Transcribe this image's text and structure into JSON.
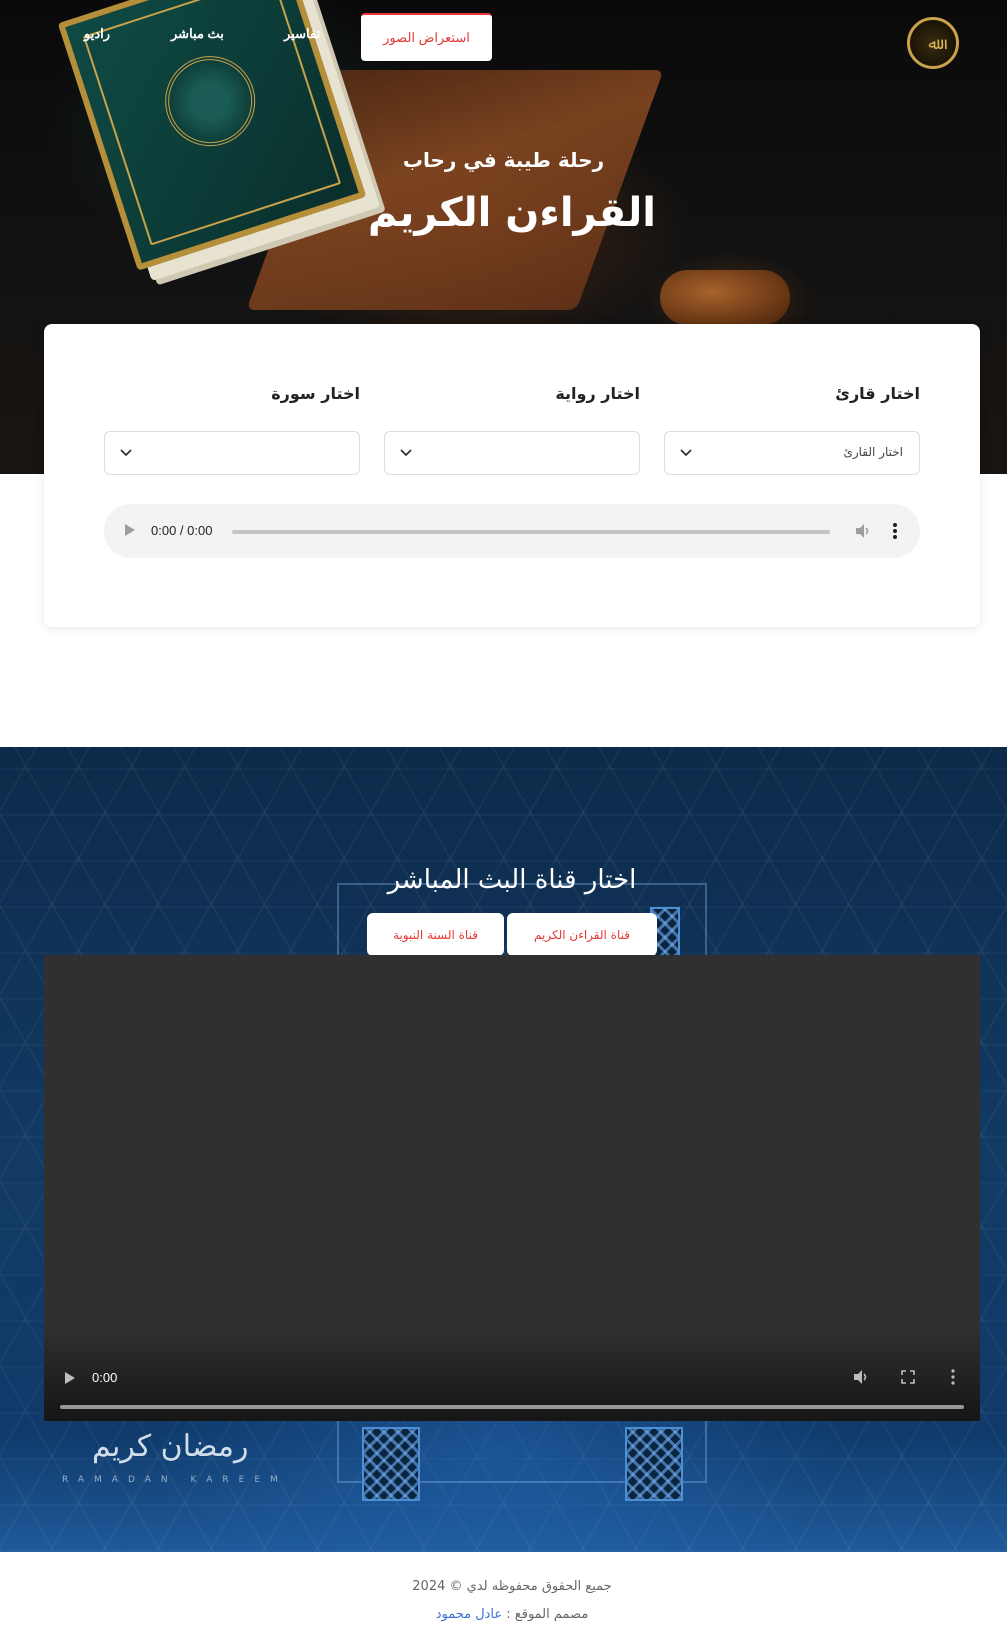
{
  "nav": {
    "logo_text": "ﷲ",
    "active": "استعراض الصور",
    "items": [
      "تفاسير",
      "بث مباشر",
      "راديو"
    ]
  },
  "hero": {
    "subtitle": "رحلة طيبة في رحاب",
    "title": "القراءن الكريم"
  },
  "player": {
    "labels": {
      "reciter": "اختار قارئ",
      "rewaya": "اختار رواية",
      "surah": "اختار سورة"
    },
    "reciter_value": "اختار القارئ",
    "rewaya_value": "",
    "surah_value": "",
    "audio_time": "0:00 / 0:00"
  },
  "live": {
    "title": "اختار قناة البث المباشر",
    "channels": [
      "قناة القراءن الكريم",
      "قناة السنة النبوية"
    ],
    "video_time": "0:00",
    "calligraphy": "رمضان كريم",
    "calligraphy_sub": "RAMADAN KAREEM"
  },
  "footer": {
    "copyright": "جميع الحقوق محفوظه لدي © 2024",
    "designer_label": "مصمم الموقع :",
    "designer_name": "عادل محمود"
  },
  "colors": {
    "accent": "#e53935",
    "link": "#3b6fd8",
    "gold": "#c9a24a"
  }
}
